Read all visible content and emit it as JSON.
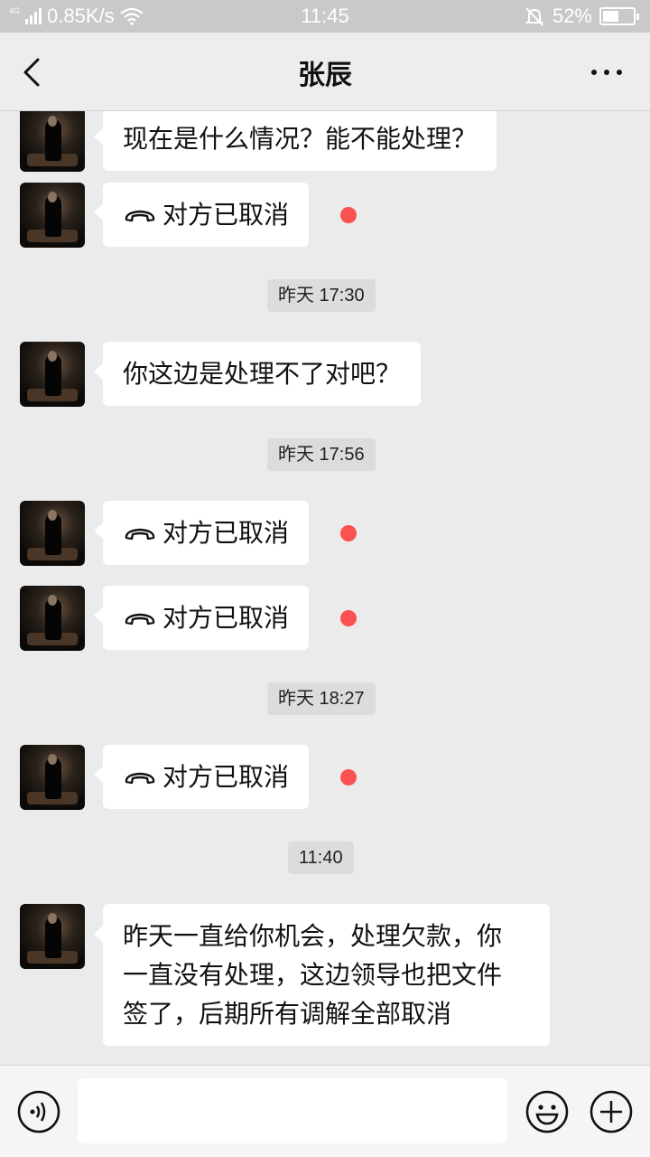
{
  "status_bar": {
    "network_type": "4G",
    "speed": "0.85K/s",
    "time": "11:45",
    "battery": "52%",
    "battery_level": 0.52
  },
  "nav": {
    "title": "张辰",
    "back_icon": "chevron-left-icon",
    "more_icon": "more-dots-icon"
  },
  "messages": [
    {
      "type": "text",
      "text": "现在是什么情况？能不能处理？"
    },
    {
      "type": "call",
      "text": "对方已取消",
      "unread": true
    },
    {
      "type": "time",
      "text": "昨天 17:30"
    },
    {
      "type": "text",
      "text": "你这边是处理不了对吧？"
    },
    {
      "type": "time",
      "text": "昨天 17:56"
    },
    {
      "type": "call",
      "text": "对方已取消",
      "unread": true
    },
    {
      "type": "call",
      "text": "对方已取消",
      "unread": true
    },
    {
      "type": "time",
      "text": "昨天 18:27"
    },
    {
      "type": "call",
      "text": "对方已取消",
      "unread": true
    },
    {
      "type": "time",
      "text": "11:40"
    },
    {
      "type": "text",
      "lines": [
        "昨天一直给你机会，处理欠款，你",
        "一直没有处理，这边领导也把文件",
        "签了，后期所有调解全部取消"
      ]
    }
  ],
  "input": {
    "value": "",
    "voice_icon": "voice-icon",
    "emoji_icon": "emoji-icon",
    "plus_icon": "plus-icon"
  },
  "colors": {
    "background": "#ebebeb",
    "bubble": "#ffffff",
    "unread_dot": "#fa5151",
    "timestamp_bg": "#dcdcdc"
  }
}
